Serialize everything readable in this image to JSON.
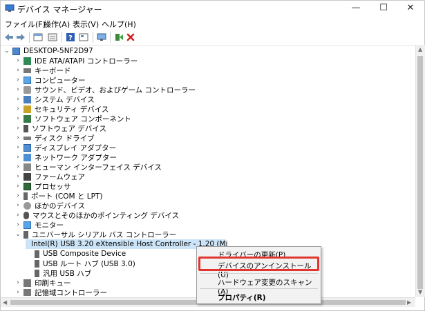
{
  "window": {
    "title": "デバイス マネージャー",
    "minimize": "—",
    "maximize": "☐",
    "close": "✕"
  },
  "menu": [
    "ファイル(F)",
    "操作(A)",
    "表示(V)",
    "ヘルプ(H)"
  ],
  "toolbar": [
    "back-icon",
    "forward-icon",
    "properties-icon",
    "show-hidden-icon",
    "help-icon",
    "view-icon",
    "monitor-icon",
    "update-driver-icon",
    "uninstall-icon"
  ],
  "tree": {
    "root": "DESKTOP-5NF2D97",
    "categories": [
      "IDE ATA/ATAPI コントローラー",
      "キーボード",
      "コンピューター",
      "サウンド、ビデオ、およびゲーム コントローラー",
      "システム デバイス",
      "セキュリティ デバイス",
      "ソフトウェア コンポーネント",
      "ソフトウェア デバイス",
      "ディスク ドライブ",
      "ディスプレイ アダプター",
      "ネットワーク アダプター",
      "ヒューマン インターフェイス デバイス",
      "ファームウェア",
      "プロセッサ",
      "ポート (COM と LPT)",
      "ほかのデバイス",
      "マウスとそのほかのポインティング デバイス",
      "モニター",
      "ユニバーサル シリアル バス コントローラー"
    ],
    "usb_children": [
      "Intel(R) USB 3.20 eXtensible Host Controller - 1.20 (Mi",
      "USB Composite Device",
      "USB ルート ハブ (USB 3.0)",
      "汎用 USB ハブ"
    ],
    "after": [
      "印刷キュー",
      "記憶域コントローラー"
    ]
  },
  "context_menu": {
    "items": [
      "ドライバーの更新(P)",
      "デバイスのアンインストール(U)",
      "ハードウェア変更のスキャン(A)",
      "プロパティ(R)"
    ]
  },
  "colors": {
    "highlight": "#e0362f",
    "selection": "#cce4f7"
  }
}
